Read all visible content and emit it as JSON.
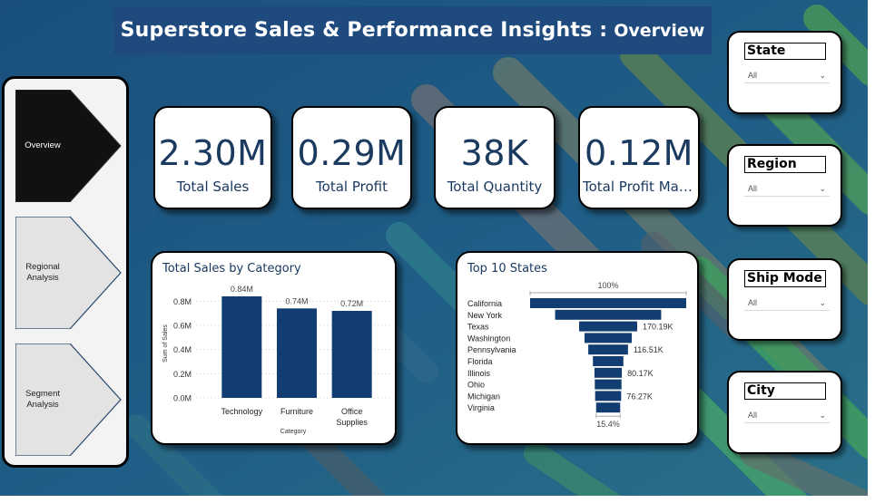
{
  "header": {
    "title": "Superstore Sales & Performance Insights :",
    "subtitle": "Overview"
  },
  "nav": {
    "items": [
      {
        "label": "Overview",
        "active": true
      },
      {
        "label": "Regional Analysis",
        "active": false
      },
      {
        "label": "Segment Analysis",
        "active": false
      }
    ]
  },
  "kpis": [
    {
      "value": "2.30M",
      "label": "Total Sales"
    },
    {
      "value": "0.29M",
      "label": "Total Profit"
    },
    {
      "value": "38K",
      "label": "Total Quantity"
    },
    {
      "value": "0.12M",
      "label": "Total Profit Margin"
    }
  ],
  "filters": [
    {
      "title": "State",
      "value": "All"
    },
    {
      "title": "Region",
      "value": "All"
    },
    {
      "title": "Ship Mode",
      "value": "All"
    },
    {
      "title": "City",
      "value": "All"
    }
  ],
  "colors": {
    "banner": "#1f4a7e",
    "bar": "#123d73",
    "kpi_text": "#1b3a60",
    "active_nav": "#111111",
    "inactive_nav": "#e3e3e3"
  },
  "chart_data": [
    {
      "type": "bar",
      "title": "Total Sales by Category",
      "xlabel": "Category",
      "ylabel": "Sum of Sales",
      "categories": [
        "Technology",
        "Furniture",
        "Office Supplies"
      ],
      "category_lines": [
        [
          "Technology"
        ],
        [
          "Furniture"
        ],
        [
          "Office",
          "Supplies"
        ]
      ],
      "values": [
        0.84,
        0.74,
        0.72
      ],
      "data_labels": [
        "0.84M",
        "0.74M",
        "0.72M"
      ],
      "yticks": [
        "0.0M",
        "0.2M",
        "0.4M",
        "0.6M",
        "0.8M"
      ],
      "ylim": [
        0,
        0.9
      ],
      "grid": true
    },
    {
      "type": "funnel",
      "title": "Top 10 States",
      "categories": [
        "California",
        "New York",
        "Texas",
        "Washington",
        "Pennsylvania",
        "Florida",
        "Illinois",
        "Ohio",
        "Michigan",
        "Virginia"
      ],
      "values": [
        457.69,
        310.88,
        170.19,
        138.64,
        116.51,
        89.47,
        80.17,
        78.26,
        76.27,
        70.64
      ],
      "data_labels": [
        "",
        "",
        "170.19K",
        "",
        "116.51K",
        "",
        "80.17K",
        "",
        "76.27K",
        ""
      ],
      "top_percent": "100%",
      "bottom_percent": "15.4%"
    }
  ]
}
